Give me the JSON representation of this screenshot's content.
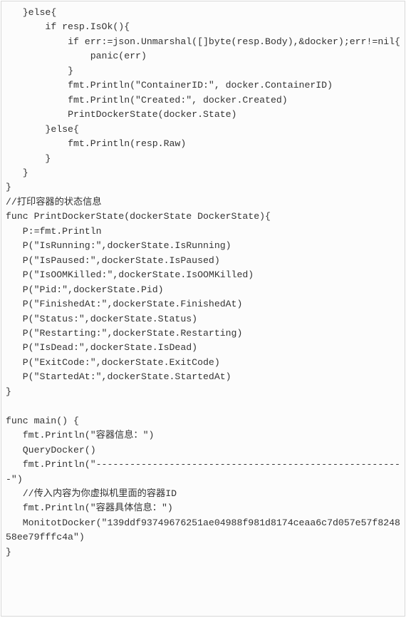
{
  "code": {
    "lines": [
      "   }else{",
      "       if resp.IsOk(){",
      "           if err:=json.Unmarshal([]byte(resp.Body),&docker);err!=nil{",
      "               panic(err)",
      "           }",
      "           fmt.Println(\"ContainerID:\", docker.ContainerID)",
      "           fmt.Println(\"Created:\", docker.Created)",
      "           PrintDockerState(docker.State)",
      "       }else{",
      "           fmt.Println(resp.Raw)",
      "       }",
      "   }",
      "}",
      "//打印容器的状态信息",
      "func PrintDockerState(dockerState DockerState){",
      "   P:=fmt.Println",
      "   P(\"IsRunning:\",dockerState.IsRunning)",
      "   P(\"IsPaused:\",dockerState.IsPaused)",
      "   P(\"IsOOMKilled:\",dockerState.IsOOMKilled)",
      "   P(\"Pid:\",dockerState.Pid)",
      "   P(\"FinishedAt:\",dockerState.FinishedAt)",
      "   P(\"Status:\",dockerState.Status)",
      "   P(\"Restarting:\",dockerState.Restarting)",
      "   P(\"IsDead:\",dockerState.IsDead)",
      "   P(\"ExitCode:\",dockerState.ExitCode)",
      "   P(\"StartedAt:\",dockerState.StartedAt)",
      "}",
      "",
      "func main() {",
      "   fmt.Println(\"容器信息：\")",
      "   QueryDocker()",
      "   fmt.Println(\"-------------------------------------------------------\")",
      "   //传入内容为你虚拟机里面的容器ID",
      "   fmt.Println(\"容器具体信息：\")",
      "   MonitotDocker(\"139ddf93749676251ae04988f981d8174ceaa6c7d057e57f824858ee79fffc4a\")",
      "}"
    ]
  }
}
